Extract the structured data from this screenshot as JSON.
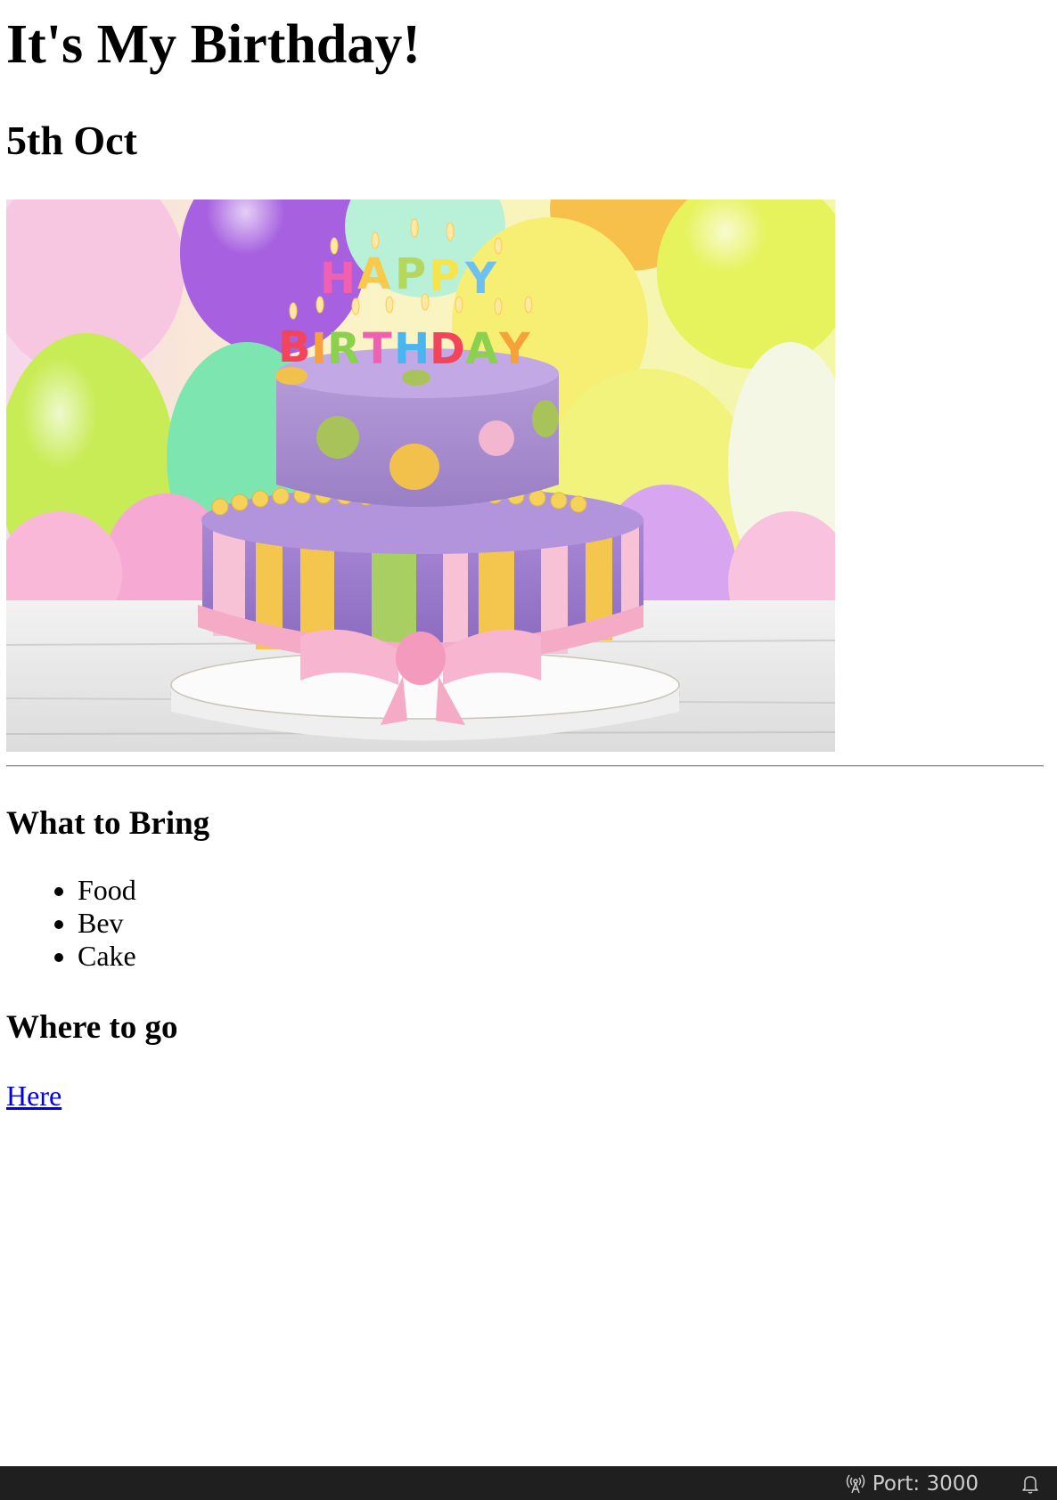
{
  "page": {
    "title": "It's My Birthday!",
    "date": "5th Oct"
  },
  "image": {
    "alt": "birthday cake",
    "icon": "cake-photo"
  },
  "bring": {
    "heading": "What to Bring",
    "items": [
      "Food",
      "Bev",
      "Cake"
    ]
  },
  "where": {
    "heading": "Where to go",
    "link_text": "Here"
  },
  "statusbar": {
    "port_label": "Port: 3000",
    "port_icon": "broadcast-icon",
    "bell_icon": "bell-icon"
  },
  "colors": {
    "link": "#0000ee",
    "statusbar_bg": "#1f1f1f",
    "statusbar_text": "#cccccc"
  }
}
